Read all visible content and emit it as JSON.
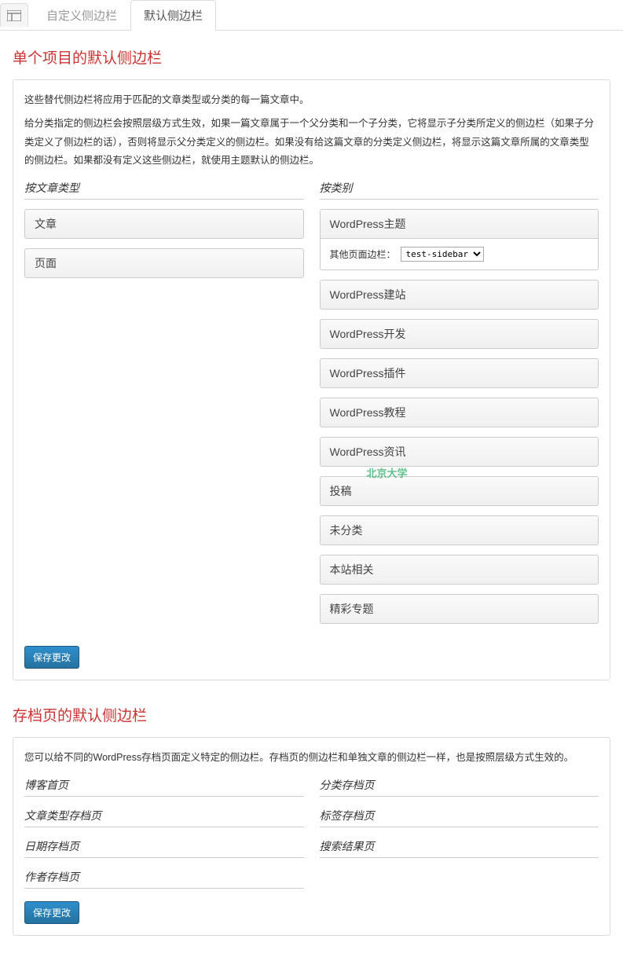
{
  "tabs": {
    "custom": "自定义侧边栏",
    "default": "默认侧边栏"
  },
  "section1": {
    "title": "单个项目的默认侧边栏",
    "desc1": "这些替代侧边栏将应用于匹配的文章类型或分类的每一篇文章中。",
    "desc2": "给分类指定的侧边栏会按照层级方式生效，如果一篇文章属于一个父分类和一个子分类，它将显示子分类所定义的侧边栏（如果子分类定义了侧边栏的话），否则将显示父分类定义的侧边栏。如果没有给这篇文章的分类定义侧边栏，将显示这篇文章所属的文章类型的侧边栏。如果都没有定义这些侧边栏，就使用主题默认的侧边栏。",
    "col1_header": "按文章类型",
    "col2_header": "按类别",
    "post_types": [
      "文章",
      "页面"
    ],
    "categories": [
      "WordPress主题",
      "WordPress建站",
      "WordPress开发",
      "WordPress插件",
      "WordPress教程",
      "WordPress资讯",
      "投稿",
      "未分类",
      "本站相关",
      "精彩专题"
    ],
    "sub_label": "其他页面边栏：",
    "sub_select": "test-sidebar",
    "watermark": "北京大学",
    "save": "保存更改"
  },
  "section2": {
    "title": "存档页的默认侧边栏",
    "desc": "您可以给不同的WordPress存档页面定义特定的侧边栏。存档页的侧边栏和单独文章的侧边栏一样，也是按照层级方式生效的。",
    "items": [
      "博客首页",
      "分类存档页",
      "文章类型存档页",
      "标签存档页",
      "日期存档页",
      "搜索结果页",
      "作者存档页"
    ],
    "save": "保存更改"
  }
}
